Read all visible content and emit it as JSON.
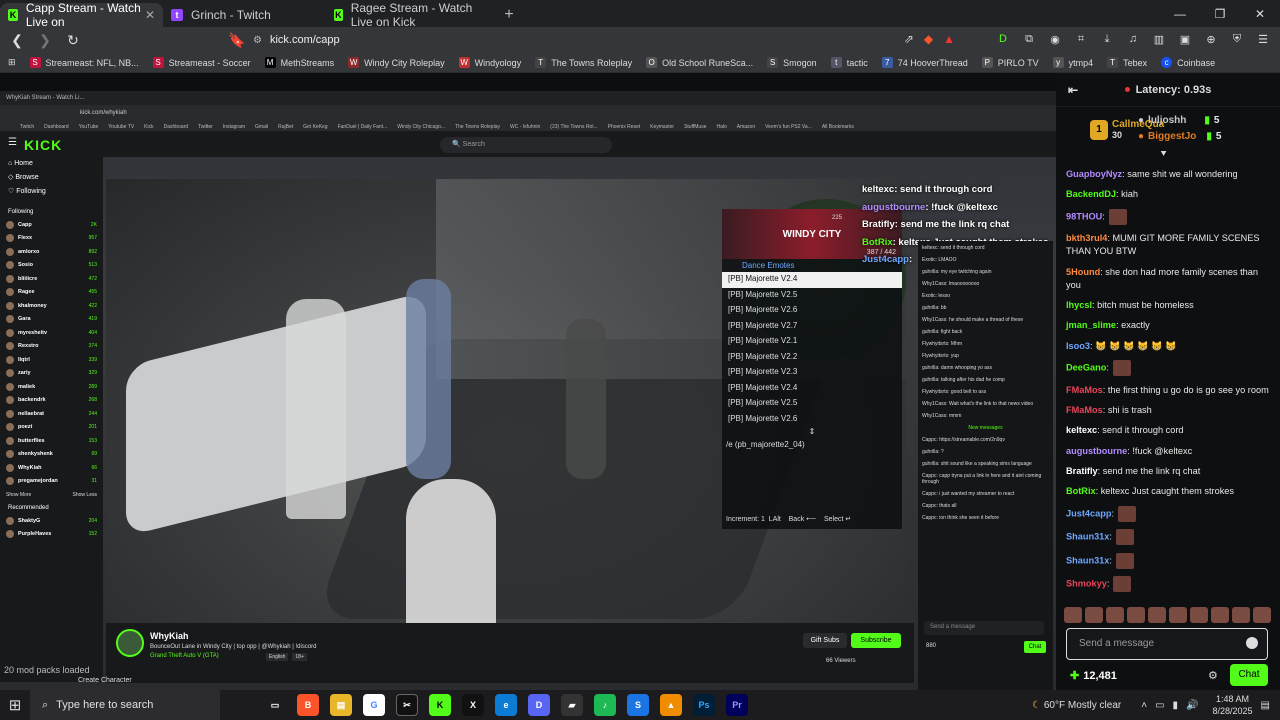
{
  "browser": {
    "tabs": [
      {
        "label": "Capp Stream - Watch Live on",
        "icon_color": "#53fc18",
        "active": true
      },
      {
        "label": "Grinch - Twitch",
        "icon_color": "#9146ff",
        "active": false
      },
      {
        "label": "Ragee Stream - Watch Live on Kick",
        "icon_color": "#53fc18",
        "active": false
      }
    ],
    "url": "kick.com/capp",
    "bookmarks": [
      "Streameast: NFL, NB...",
      "Streameast - Soccer",
      "MethStreams",
      "Windy City Roleplay",
      "Windyology",
      "The Towns Roleplay",
      "Old School RuneSca...",
      "Smogon",
      "tactic",
      "74 HooverThread",
      "PIRLO TV",
      "ytmp4",
      "Tebex",
      "Coinbase"
    ]
  },
  "stream": {
    "inner_tab": "WhyKiah Stream - Watch Li...",
    "inner_url": "kick.com/whykiah",
    "inner_search": "Search",
    "inner_bookmarks": [
      "Twitch",
      "Dashboard",
      "YouTube",
      "Youtube TV",
      "Kick",
      "Dashboard",
      "Twitter",
      "Instagram",
      "Gmail",
      "RajBet",
      "Get KeKeg",
      "FanDuel | Daily Fant...",
      "Windy City Chicago...",
      "The Towns Roleplay",
      "WC - Isfuhnin",
      "(23) The Towns Rol...",
      "Phoenix Reset",
      "Keymaster",
      "StuffMuse",
      "Halo",
      "Amazon",
      "Veem's fun PS2 Va...",
      "All Bookmarks"
    ],
    "inner_nav": [
      "Home",
      "Browse",
      "Following"
    ],
    "inner_following_title": "Following",
    "inner_following": [
      {
        "name": "Capp",
        "count": "2K"
      },
      {
        "name": "Flexx",
        "count": "957"
      },
      {
        "name": "amlorxo",
        "count": "892"
      },
      {
        "name": "Sosio",
        "count": "513"
      },
      {
        "name": "bliiiicre",
        "count": "472"
      },
      {
        "name": "Ragee",
        "count": "455"
      },
      {
        "name": "khalmoney",
        "count": "422"
      },
      {
        "name": "Gara",
        "count": "419"
      },
      {
        "name": "myresheitv",
        "count": "404"
      },
      {
        "name": "Rexstro",
        "count": "374"
      },
      {
        "name": "llqtrl",
        "count": "339"
      },
      {
        "name": "zariy",
        "count": "329"
      },
      {
        "name": "maliek",
        "count": "289"
      },
      {
        "name": "backendrk",
        "count": "268"
      },
      {
        "name": "nellaebrat",
        "count": "244"
      },
      {
        "name": "poezt",
        "count": "201"
      },
      {
        "name": "butterflies",
        "count": "153"
      },
      {
        "name": "shenkyshenk",
        "count": "69"
      },
      {
        "name": "WhyKiah",
        "count": "66"
      },
      {
        "name": "pregamejordan",
        "count": "31"
      }
    ],
    "inner_show_more": "Show More",
    "inner_show_less": "Show Less",
    "inner_recommended": "Recommended",
    "inner_rec": [
      {
        "name": "ShaktyG",
        "count": "204"
      },
      {
        "name": "PurpleHaves",
        "count": "152"
      }
    ],
    "inner_create": "Create Character",
    "mod_text": "20 mod packs loaded",
    "overlay_chat": [
      {
        "user": "keltexc",
        "text": ": send it through cord",
        "color": "#ffffff"
      },
      {
        "user": "augustbourne",
        "text": ": !fuck @keltexc",
        "color": "#b28bff"
      },
      {
        "user": "Bratifly",
        "text": ": send me the link rq chat",
        "color": "#ffffff"
      },
      {
        "user": "BotRix",
        "text": ": keltexc Just caught them strokes",
        "color": "#53fc18"
      },
      {
        "user": "Just4capp",
        "text": ":",
        "color": "#6fa7ff"
      }
    ],
    "emote_menu": {
      "banner": "WINDY CITY",
      "counter": "387 / 442",
      "small_counter": "225",
      "heading": "Dance Emotes",
      "items": [
        "[PB] Majorette V2.4",
        "[PB] Majorette V2.5",
        "[PB] Majorette V2.6",
        "[PB] Majorette V2.7",
        "[PB] Majorette V2.1",
        "[PB] Majorette V2.2",
        "[PB] Majorette V2.3",
        "[PB] Majorette V2.4",
        "[PB] Majorette V2.5",
        "[PB] Majorette V2.6"
      ],
      "command": "/e (pb_majorette2_04)",
      "footer": "Increment: 1  LAlt    Back ⟵    Select ↵"
    },
    "mini_chat": [
      "keltexc: send it through cord",
      "Exotic: LMAOO",
      "guhrilla: my eye twitching again",
      "Why1Cass: lmaoooooooo",
      "Exotic: lesso",
      "guhrilla: bb",
      "Why1Cass: he should make a thread of these",
      "guhrilla: fight back",
      "Flywhyitsrts: Mhm",
      "Flywhyitsrts: yup",
      "guhrilla: damn whooping yo ass",
      "guhrilla: talking after his dad he comp",
      "Flywhyitsrts: good belt to ass",
      "Why1Cass: Wait what's the link to that news video",
      "Why1Cass: mmm",
      "New messages",
      "Cappc: https://streamable.com/2n9qv",
      "guhrilla: ?",
      "guhrilla: shit sound like a speaking sims language",
      "Cappc: capp tryna put a link in here and it aint coming through",
      "Cappc: i just wanted my streamer to react",
      "Cappc: thats all",
      "Cappc: ion think she seen it before"
    ],
    "inner_send_placeholder": "Send a message",
    "inner_points": "880",
    "inner_chat_btn": "Chat",
    "streamer": {
      "name": "WhyKiah",
      "title": "BounceOut Lane in Windy City | top opp | @Whykiah | !discord",
      "game": "Grand Theft Auto V (GTA)",
      "tags": [
        "English",
        "18+"
      ],
      "viewers": "66 Viewers",
      "gift": "Gift Subs",
      "subscribe": "Subscribe"
    }
  },
  "chat": {
    "latency": "Latency: 0.93s",
    "leaders": [
      {
        "rank": "1",
        "name": "CallmeQua",
        "score": "30",
        "color": "#e0a823"
      },
      {
        "rank": "",
        "name": "luljoshh",
        "score": "5",
        "color": "#c9c9c9"
      },
      {
        "rank": "",
        "name": "BiggestJo",
        "score": "5",
        "color": "#e07b23"
      }
    ],
    "messages": [
      {
        "user": "GuapboyNyz",
        "text": ": same shit we all wondering",
        "color": "#b28bff",
        "emote": false
      },
      {
        "user": "BackendDJ",
        "text": ": kiah",
        "color": "#53fc18",
        "emote": false
      },
      {
        "user": "98THOU",
        "text": ":",
        "color": "#b28bff",
        "emote": true
      },
      {
        "user": "bkth3rul4",
        "text": ": MUMI GIT MORE FAMILY SCENES THAN YOU BTW",
        "color": "#ff8a3d",
        "emote": false
      },
      {
        "user": "5Hound",
        "text": ": she don had more family scenes than you",
        "color": "#ff8a3d",
        "emote": false
      },
      {
        "user": "lhycsl",
        "text": ": bitch must be homeless",
        "color": "#53fc18",
        "emote": false
      },
      {
        "user": "jman_slime",
        "text": ": exactly",
        "color": "#53fc18",
        "emote": false
      },
      {
        "user": "Isoo3",
        "text": ": 😸 😸 😸 😸 😸 😸",
        "color": "#6fa7ff",
        "emote": false
      },
      {
        "user": "DeeGano",
        "text": ":",
        "color": "#53fc18",
        "emote": true
      },
      {
        "user": "FMaMos",
        "text": ": the first thing u go do is go see yo room",
        "color": "#e8445a",
        "emote": false
      },
      {
        "user": "FMaMos",
        "text": ": shi is trash",
        "color": "#e8445a",
        "emote": false
      },
      {
        "user": "keltexc",
        "text": ": send it through cord",
        "color": "#ffffff",
        "emote": false
      },
      {
        "user": "augustbourne",
        "text": ": !fuck @keltexc",
        "color": "#b28bff",
        "emote": false
      },
      {
        "user": "Bratifly",
        "text": ": send me the link rq chat",
        "color": "#ffffff",
        "emote": false
      },
      {
        "user": "BotRix",
        "text": ": keltexc Just caught them strokes",
        "color": "#53fc18",
        "emote": false
      },
      {
        "user": "Just4capp",
        "text": ":",
        "color": "#6fa7ff",
        "emote": true
      },
      {
        "user": "Shaun31x",
        "text": ":",
        "color": "#6fa7ff",
        "emote": true
      },
      {
        "user": "Shaun31x",
        "text": ":",
        "color": "#6fa7ff",
        "emote": true
      },
      {
        "user": "Shmokyy",
        "text": ":",
        "color": "#e8445a",
        "emote": true
      }
    ],
    "input_placeholder": "Send a message",
    "points": "12,481",
    "chat_button": "Chat"
  },
  "taskbar": {
    "search_placeholder": "Type here to search",
    "weather": "60°F  Mostly clear",
    "time": "1:48 AM",
    "date": "8/28/2025"
  }
}
